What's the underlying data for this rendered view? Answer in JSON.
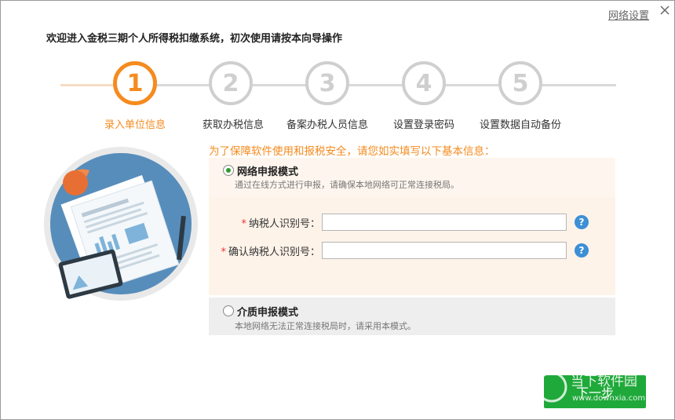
{
  "header": {
    "net_settings": "网络设置",
    "welcome": "欢迎进入金税三期个人所得税扣缴系统，初次使用请按本向导操作"
  },
  "steps": [
    {
      "num": "1",
      "label": "录入单位信息",
      "state": "active"
    },
    {
      "num": "2",
      "label": "获取办税信息",
      "state": "todo"
    },
    {
      "num": "3",
      "label": "备案办税人员信息",
      "state": "todo"
    },
    {
      "num": "4",
      "label": "设置登录密码",
      "state": "todo"
    },
    {
      "num": "5",
      "label": "设置数据自动备份",
      "state": "todo"
    }
  ],
  "notice": "为了保障软件使用和报税安全，请您如实填写以下基本信息：",
  "online_mode": {
    "title": "网络申报模式",
    "desc": "通过在线方式进行申报，请确保本地网络可正常连接税局。",
    "selected": true,
    "fields": [
      {
        "label": "纳税人识别号：",
        "value": "",
        "required": "*"
      },
      {
        "label": "确认纳税人识别号：",
        "value": "",
        "required": "*"
      }
    ],
    "help": "?"
  },
  "media_mode": {
    "title": "介质申报模式",
    "desc": "本地网络无法正常连接税局时，请采用本模式。",
    "selected": false
  },
  "next_button": "下一步",
  "watermark": {
    "title": "当下软件园",
    "url": "www.downxia.com"
  },
  "colors": {
    "accent": "#f58b1f",
    "primary_button": "#1fa93a",
    "help": "#3d8fd6"
  }
}
